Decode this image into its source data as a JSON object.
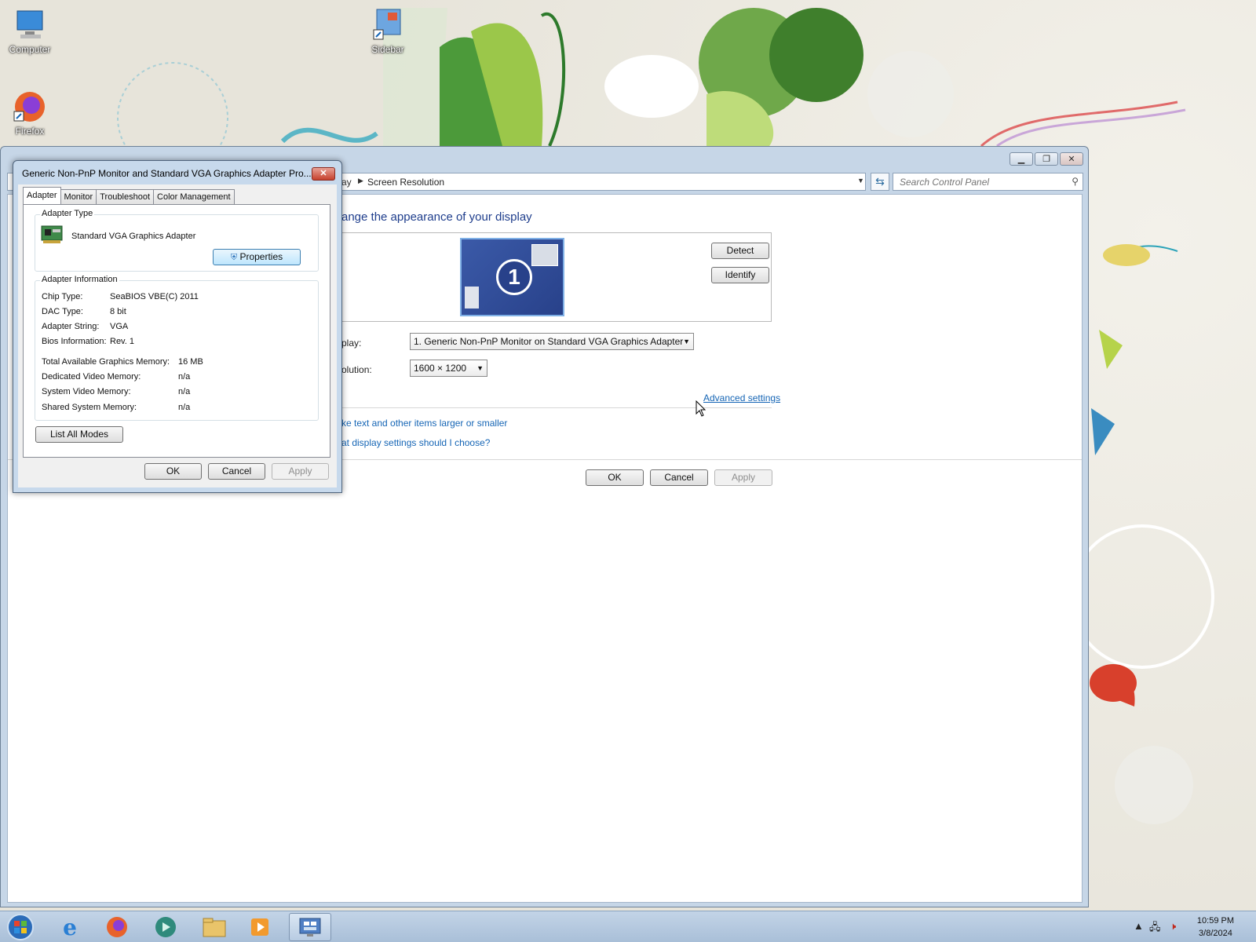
{
  "desktop": {
    "icons": [
      {
        "label": "Computer"
      },
      {
        "label": "Firefox"
      },
      {
        "label": "Sidebar"
      }
    ]
  },
  "main_window": {
    "breadcrumb_prev": "ay",
    "breadcrumb_current": "Screen Resolution",
    "search_placeholder": "Search Control Panel",
    "heading": "ange the appearance of your display",
    "monitor_number": "1",
    "detect_label": "Detect",
    "identify_label": "Identify",
    "display_label": "play:",
    "display_value": "1. Generic Non-PnP Monitor on Standard VGA Graphics Adapter",
    "resolution_label": "olution:",
    "resolution_value": "1600 × 1200",
    "advanced_link": "Advanced settings",
    "link_text_size": "ke text and other items larger or smaller",
    "link_which_settings": "at display settings should I choose?",
    "ok_label": "OK",
    "cancel_label": "Cancel",
    "apply_label": "Apply"
  },
  "dialog": {
    "title": "Generic Non-PnP Monitor and Standard VGA Graphics Adapter Pro...",
    "close_glyph": "✕",
    "tabs": [
      {
        "label": "Adapter"
      },
      {
        "label": "Monitor"
      },
      {
        "label": "Troubleshoot"
      },
      {
        "label": "Color Management"
      }
    ],
    "adapter_type_title": "Adapter Type",
    "adapter_name": "Standard VGA Graphics Adapter",
    "properties_label": "Properties",
    "adapter_info_title": "Adapter Information",
    "info": [
      {
        "key": "Chip Type:",
        "value": "SeaBIOS VBE(C) 2011"
      },
      {
        "key": "DAC Type:",
        "value": "8 bit"
      },
      {
        "key": "Adapter String:",
        "value": "VGA"
      },
      {
        "key": "Bios Information:",
        "value": "Rev. 1"
      }
    ],
    "memory": [
      {
        "key": "Total Available Graphics Memory:",
        "value": "16 MB"
      },
      {
        "key": "Dedicated Video Memory:",
        "value": "n/a"
      },
      {
        "key": "System Video Memory:",
        "value": "n/a"
      },
      {
        "key": "Shared System Memory:",
        "value": "n/a"
      }
    ],
    "list_modes_label": "List All Modes",
    "ok_label": "OK",
    "cancel_label": "Cancel",
    "apply_label": "Apply"
  },
  "taskbar": {
    "time": "10:59 PM",
    "date": "3/8/2024"
  },
  "colors": {
    "accent": "#1e3d8c",
    "link": "#1565b5",
    "taskbar": "#b7cbe2"
  }
}
